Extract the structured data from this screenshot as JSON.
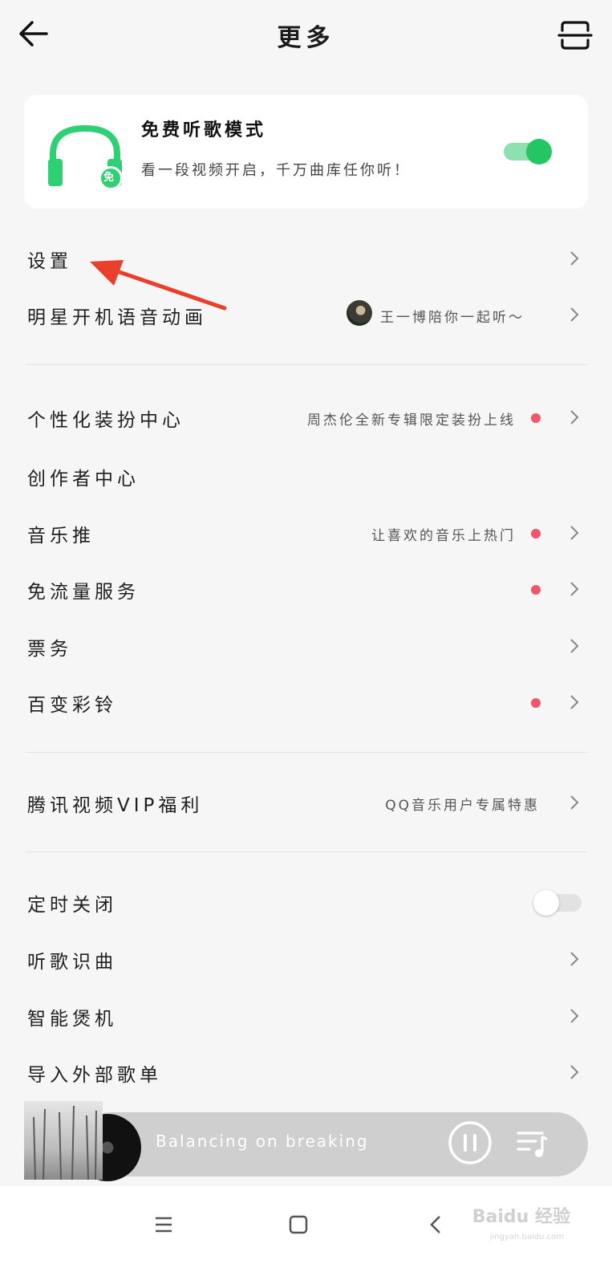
{
  "header": {
    "title": "更多"
  },
  "free_mode": {
    "title": "免费听歌模式",
    "subtitle": "看一段视频开启，千万曲库任你听！",
    "badge": "免",
    "enabled": true
  },
  "section1": [
    {
      "label": "设置"
    },
    {
      "label": "明星开机语音动画",
      "sub": "王一博陪你一起听～"
    }
  ],
  "section2": [
    {
      "label": "个性化装扮中心",
      "sub": "周杰伦全新专辑限定装扮上线",
      "dot": true
    },
    {
      "label": "创作者中心"
    },
    {
      "label": "音乐推",
      "sub": "让喜欢的音乐上热门",
      "dot": true
    },
    {
      "label": "免流量服务",
      "dot": true
    },
    {
      "label": "票务"
    },
    {
      "label": "百变彩铃",
      "dot": true
    }
  ],
  "section3": [
    {
      "label": "腾讯视频VIP福利",
      "sub": "QQ音乐用户专属特惠"
    }
  ],
  "section4": [
    {
      "label": "定时关闭",
      "toggle": false
    },
    {
      "label": "听歌识曲"
    },
    {
      "label": "智能煲机"
    },
    {
      "label": "导入外部歌单"
    }
  ],
  "player": {
    "song": "Balancing on breaking",
    "state": "playing"
  },
  "watermark": {
    "text": "Baidu 经验",
    "sub": "jingyan.baidu.com"
  },
  "colors": {
    "accent_green": "#23c663",
    "red_dot": "#f0556a",
    "annotation_arrow": "#e8402a"
  },
  "icons": [
    "back-arrow-icon",
    "scan-icon",
    "headphones-icon",
    "chevron-right-icon",
    "pause-icon",
    "playlist-icon",
    "menu-icon",
    "home-icon",
    "back-nav-icon"
  ]
}
